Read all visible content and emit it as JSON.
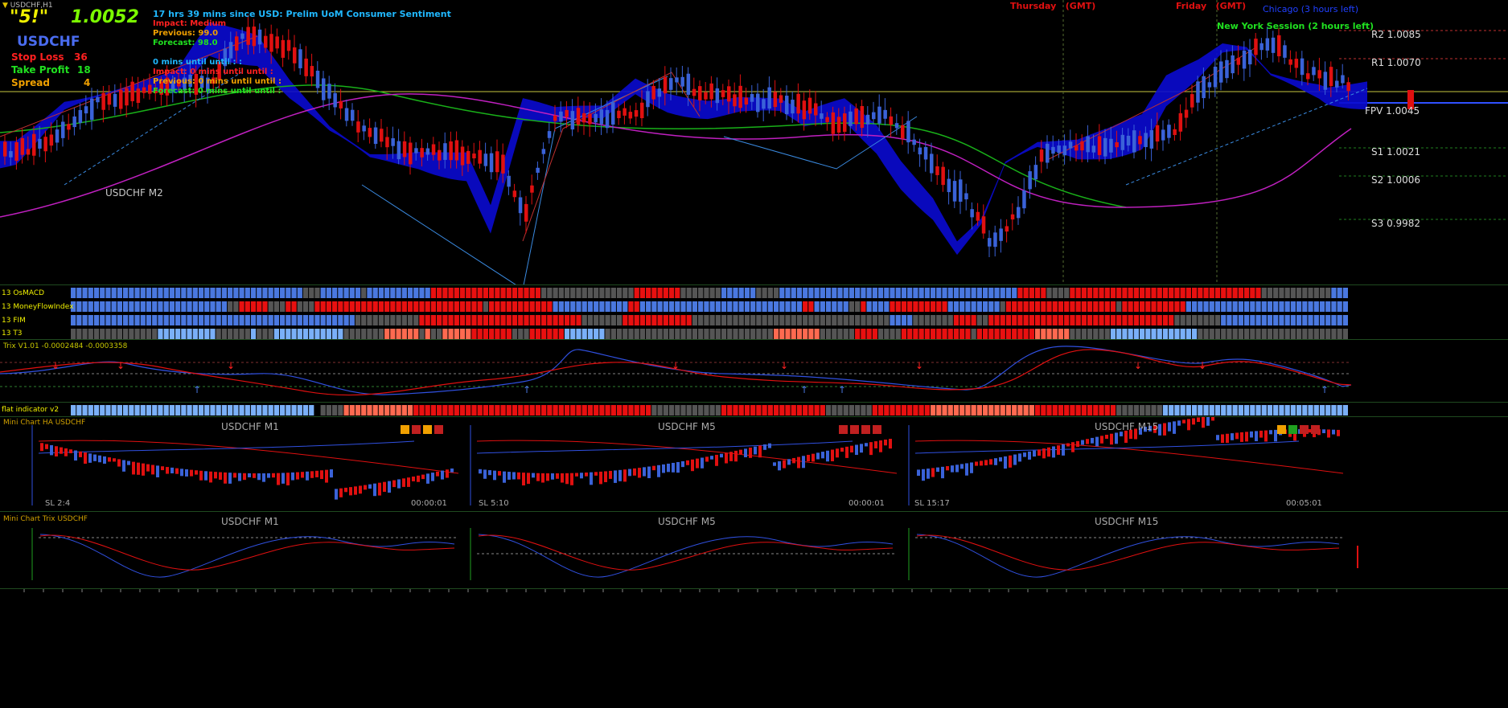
{
  "window": {
    "title": "USDCHF,H1"
  },
  "topleft": {
    "badge": "\"5!\"",
    "price": "1.0052",
    "symbol": "USDCHF",
    "stop_loss_label": "Stop Loss",
    "stop_loss_value": "36",
    "take_profit_label": "Take Profit",
    "take_profit_value": "18",
    "spread_label": "Spread",
    "spread_value": "4"
  },
  "news": {
    "line1": "17 hrs 39 mins since USD: Prelim UoM Consumer Sentiment",
    "line2": "Impact: Medium",
    "line3": "Previous: 99.0",
    "line4": "Forecast: 98.0",
    "line5": "0 mins until until : :",
    "line6": "Impact: 0 mins until until :",
    "line7": "Previous: 0 mins until until :",
    "line8": "Forecast: 0 mins until until :"
  },
  "sessions": {
    "thursday": "Thursday",
    "thursday_gmt": "(GMT)",
    "friday": "Friday",
    "friday_gmt": "(GMT)",
    "chicago": "Chicago (3 hours left)",
    "newyork": "New York Session (2 hours left)"
  },
  "pivots": [
    {
      "name": "R2",
      "value": "1.0085"
    },
    {
      "name": "R1",
      "value": "1.0070"
    },
    {
      "name": "FPV",
      "value": "1.0045"
    },
    {
      "name": "S1",
      "value": "1.0021"
    },
    {
      "name": "S2",
      "value": "1.0006"
    },
    {
      "name": "S3",
      "value": "0.9982"
    }
  ],
  "main_chart": {
    "label": "USDCHF  M2"
  },
  "indicators": {
    "row1": "13 OsMACD",
    "row2": "13 MoneyFlowIndex",
    "row3": "13 FIM",
    "row4": "13 T3",
    "trix": "Trix V1.01 -0.0002484 -0.0003358",
    "flat": "flat indicator v2"
  },
  "mini_ha": {
    "title": "Mini Chart HA USDCHF",
    "panels": [
      {
        "tf": "USDCHF  M1",
        "sl": "SL 2:4",
        "timer": "00:00:01"
      },
      {
        "tf": "USDCHF  M5",
        "sl": "SL 5:10",
        "timer": "00:00:01"
      },
      {
        "tf": "USDCHF  M15",
        "sl": "SL 15:17",
        "timer": "00:05:01"
      }
    ]
  },
  "mini_trix": {
    "title": "Mini Chart Trix USDCHF",
    "panels": [
      {
        "tf": "USDCHF  M1"
      },
      {
        "tf": "USDCHF  M5"
      },
      {
        "tf": "USDCHF  M15"
      }
    ]
  },
  "colors": {
    "bull": "#3a62d8",
    "bear": "#e01010",
    "cloud": "#0a0ad0",
    "ma_green": "#19b019",
    "ma_magenta": "#c020c0",
    "grid": "#1e4b1e"
  }
}
